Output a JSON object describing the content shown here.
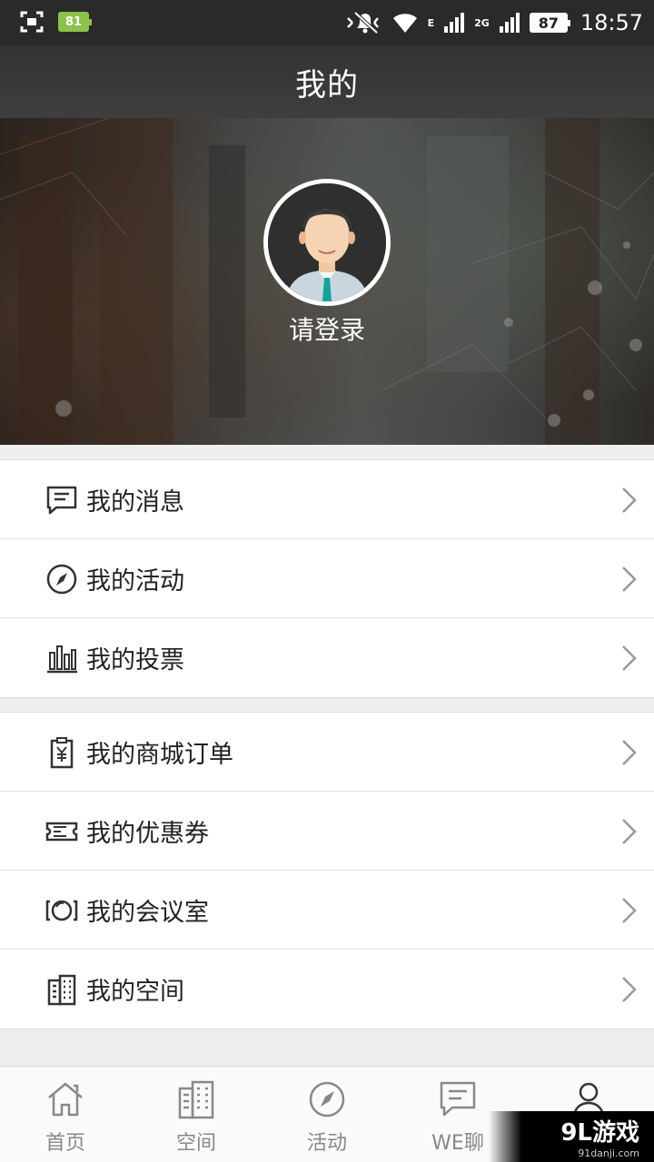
{
  "status_bar": {
    "battery_small": "81",
    "network_e": "E",
    "network_2g": "2G",
    "battery_level": "87",
    "time": "18:57"
  },
  "header": {
    "title": "我的"
  },
  "profile": {
    "login_prompt": "请登录"
  },
  "menu_groups": [
    {
      "items": [
        {
          "label": "我的消息",
          "icon": "message-icon"
        },
        {
          "label": "我的活动",
          "icon": "compass-icon"
        },
        {
          "label": "我的投票",
          "icon": "bar-chart-icon"
        }
      ]
    },
    {
      "items": [
        {
          "label": "我的商城订单",
          "icon": "order-clipboard-icon"
        },
        {
          "label": "我的优惠券",
          "icon": "ticket-icon"
        },
        {
          "label": "我的会议室",
          "icon": "meeting-room-icon"
        },
        {
          "label": "我的空间",
          "icon": "building-icon"
        }
      ]
    }
  ],
  "tabs": [
    {
      "label": "首页",
      "icon": "home-icon"
    },
    {
      "label": "空间",
      "icon": "building-icon"
    },
    {
      "label": "活动",
      "icon": "compass-icon"
    },
    {
      "label": "WE聊",
      "icon": "chat-icon"
    },
    {
      "label": "",
      "icon": "user-icon",
      "active": true
    }
  ],
  "watermark": {
    "main": "9L游戏",
    "sub": "91danji.com"
  },
  "colors": {
    "header_bg": "#333333",
    "text": "#222222",
    "tab_text": "#888888",
    "divider": "#e0e0e0"
  }
}
